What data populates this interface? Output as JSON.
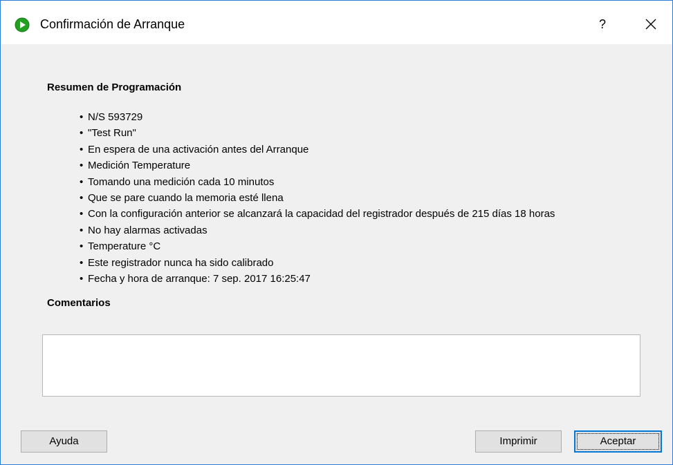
{
  "window": {
    "title": "Confirmación de Arranque",
    "help_label": "?",
    "close_label": "✕",
    "app_icon": "green-play-icon",
    "accent_color": "#2b7bd6",
    "icon_color": "#21a021"
  },
  "summary": {
    "heading": "Resumen de Programación",
    "items": [
      "N/S 593729",
      "\"Test Run\"",
      "En espera de una activación antes del Arranque",
      "Medición Temperature",
      "Tomando una medición cada 10 minutos",
      "Que se pare cuando la memoria esté llena",
      "Con la configuración anterior se alcanzará la capacidad del registrador después de 215 días 18 horas",
      "No hay alarmas activadas",
      "Temperature °C",
      "Este registrador nunca ha sido calibrado",
      "Fecha y hora de arranque: 7 sep. 2017 16:25:47"
    ]
  },
  "comments": {
    "heading": "Comentarios",
    "value": ""
  },
  "buttons": {
    "help": "Ayuda",
    "print": "Imprimir",
    "accept": "Aceptar"
  }
}
